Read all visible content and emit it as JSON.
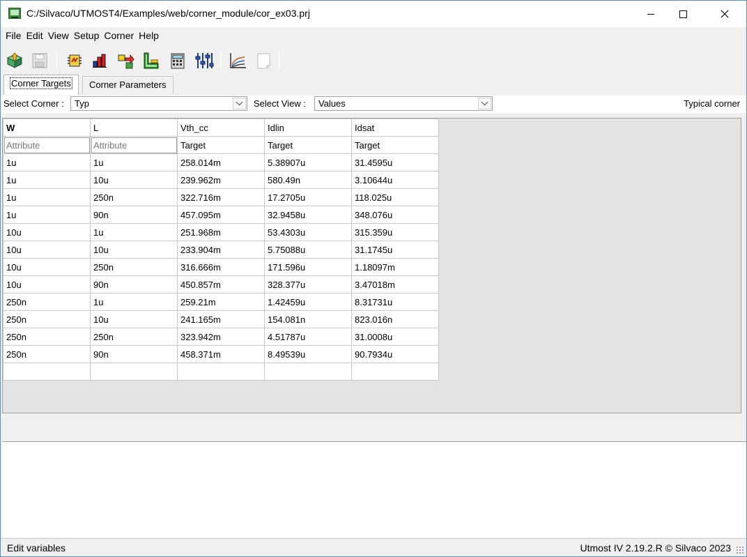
{
  "window": {
    "title": "C:/Silvaco/UTMOST4/Examples/web/corner_module/cor_ex03.prj",
    "minimize_glyph": "—",
    "maximize_glyph": "☐",
    "close_glyph": "✕"
  },
  "menu": [
    "File",
    "Edit",
    "View",
    "Setup",
    "Corner",
    "Help"
  ],
  "toolbar": {
    "icons": [
      "open-project-icon",
      "save-icon",
      "module-settings-icon",
      "bar-chart-icon",
      "transfer-icon",
      "l-shape-icon",
      "calculator-icon",
      "sliders-icon",
      "plot-curves-icon",
      "blank-page-icon"
    ]
  },
  "tabs": [
    "Corner Targets",
    "Corner Parameters"
  ],
  "selectors": {
    "corner_label": "Select Corner :",
    "corner_value": "Typ",
    "view_label": "Select View :",
    "view_value": "Values",
    "status_text": "Typical corner"
  },
  "grid": {
    "columns": [
      "W",
      "L",
      "Vth_cc",
      "Idlin",
      "Idsat"
    ],
    "subheaders": [
      "Attribute",
      "Attribute",
      "Target",
      "Target",
      "Target"
    ],
    "rows": [
      [
        "1u",
        "1u",
        "258.014m",
        "5.38907u",
        "31.4595u"
      ],
      [
        "1u",
        "10u",
        "239.962m",
        "580.49n",
        "3.10644u"
      ],
      [
        "1u",
        "250n",
        "322.716m",
        "17.2705u",
        "118.025u"
      ],
      [
        "1u",
        "90n",
        "457.095m",
        "32.9458u",
        "348.076u"
      ],
      [
        "10u",
        "1u",
        "251.968m",
        "53.4303u",
        "315.359u"
      ],
      [
        "10u",
        "10u",
        "233.904m",
        "5.75088u",
        "31.1745u"
      ],
      [
        "10u",
        "250n",
        "316.666m",
        "171.596u",
        "1.18097m"
      ],
      [
        "10u",
        "90n",
        "450.857m",
        "328.377u",
        "3.47018m"
      ],
      [
        "250n",
        "1u",
        "259.21m",
        "1.42459u",
        "8.31731u"
      ],
      [
        "250n",
        "10u",
        "241.165m",
        "154.081n",
        "823.016n"
      ],
      [
        "250n",
        "250n",
        "323.942m",
        "4.51787u",
        "31.0008u"
      ],
      [
        "250n",
        "90n",
        "458.371m",
        "8.49539u",
        "90.7934u"
      ],
      [
        "",
        "",
        "",
        "",
        ""
      ]
    ]
  },
  "statusbar": {
    "left": "Edit variables",
    "right": "Utmost IV 2.19.2.R © Silvaco 2023"
  }
}
